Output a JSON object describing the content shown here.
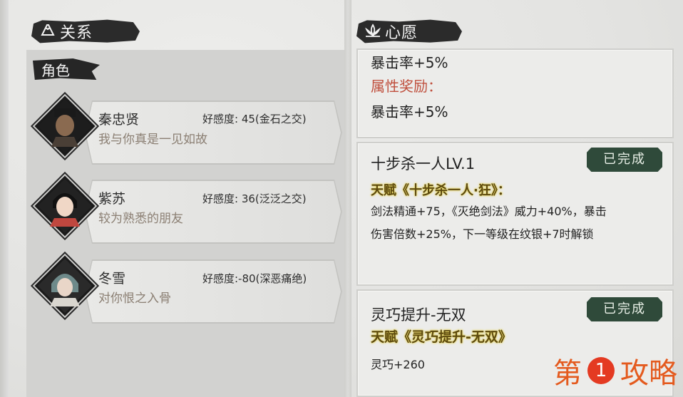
{
  "relations_header": {
    "title": "关系",
    "icon": "clasped-hands-icon"
  },
  "wish_header": {
    "title": "心愿",
    "icon": "lotus-icon"
  },
  "role_tab": {
    "title": "角色"
  },
  "characters": [
    {
      "name": "秦忠贤",
      "affinity": "好感度: 45(金石之交)",
      "quote": "我与你真是一见如故"
    },
    {
      "name": "紫苏",
      "affinity": "好感度: 36(泛泛之交)",
      "quote": "较为熟悉的朋友"
    },
    {
      "name": "冬雪",
      "affinity": "好感度:-80(深恶痛绝)",
      "quote": "对你恨之入骨"
    }
  ],
  "wishes": [
    {
      "line1": "暴击率+5%",
      "reward_label": "属性奖励：",
      "line2": "暴击率+5%"
    },
    {
      "title": "十步杀一人LV.1",
      "status": "已完成",
      "talent": "天赋《十步杀一人·狂》：",
      "desc1": "剑法精通+75，《灭绝剑法》威力+40%，暴击",
      "desc2": "伤害倍数+25%，下一等级在纹银+7时解锁"
    },
    {
      "title": "灵巧提升-无双",
      "status": "已完成",
      "talent": "天赋《灵巧提升-无双》",
      "desc1": "灵巧+260"
    }
  ],
  "watermark": {
    "left": "第",
    "num": "1",
    "right": "攻略"
  }
}
